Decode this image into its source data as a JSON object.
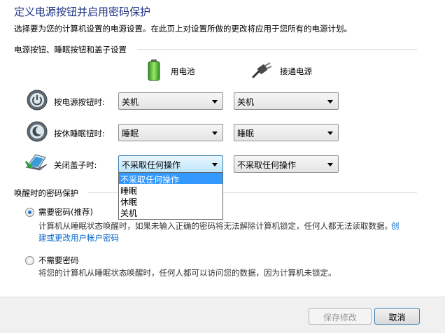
{
  "header": {
    "title": "定义电源按钮并启用密码保护",
    "subtitle": "选择要为您的计算机设置的电源设置。在此页上对设置所做的更改将应用于您所有的电源计划。"
  },
  "buttons_section": {
    "heading": "电源按钮、睡眠按钮和盖子设置",
    "col_battery": "用电池",
    "col_plugged": "接通电源",
    "rows": [
      {
        "label": "按电源按钮时:",
        "battery": "关机",
        "plugged": "关机"
      },
      {
        "label": "按休睡眠钮时:",
        "battery": "睡眠",
        "plugged": "睡眠"
      },
      {
        "label": "关闭盖子时:",
        "battery": "不采取任何操作",
        "plugged": "不采取任何操作"
      }
    ]
  },
  "dropdown": {
    "options": [
      "不采取任何操作",
      "睡眠",
      "休眠",
      "关机"
    ],
    "selected_index": 0
  },
  "password_section": {
    "heading": "唤醒时的密码保护",
    "require_label": "需要密码(推荐)",
    "require_desc": "计算机从睡眠状态唤醒时，如果未输入正确的密码将无法解除计算机锁定，任何人都无法读取数据。",
    "require_link_part1": "创",
    "require_link_part2": "建或更改用户帐户密码",
    "no_require_label": "不需要密码",
    "no_require_desc": "将您的计算机从睡眠状态唤醒时，任何人都可以访问您的数据，因为计算机未锁定。",
    "selected": "require"
  },
  "footer": {
    "save_label": "保存修改",
    "cancel_label": "取消"
  },
  "colors": {
    "title": "#1e3287",
    "link": "#0066cc",
    "selection": "#3399ff"
  }
}
